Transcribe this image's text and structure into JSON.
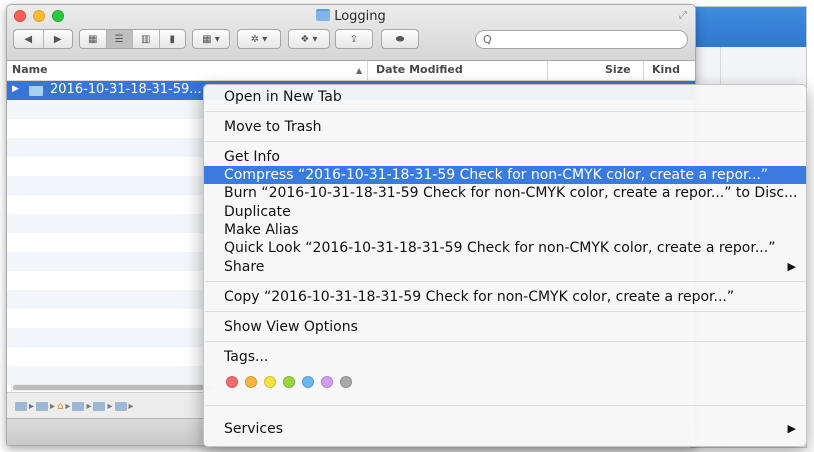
{
  "window": {
    "title": "Logging",
    "search_placeholder": "Q"
  },
  "columns": [
    "Name",
    "Date Modified",
    "Size",
    "Kind"
  ],
  "selected_row": {
    "name": "2016-10-31-18-31-59..."
  },
  "context_menu": {
    "items": [
      {
        "label": "Open in New Tab"
      },
      {
        "label": "Move to Trash"
      },
      {
        "label": "Get Info"
      },
      {
        "label": "Compress “2016-10-31-18-31-59 Check for non-CMYK color, create a repor...”"
      },
      {
        "label": "Burn “2016-10-31-18-31-59 Check for non-CMYK color, create a repor...” to Disc..."
      },
      {
        "label": "Duplicate"
      },
      {
        "label": "Make Alias"
      },
      {
        "label": "Quick Look “2016-10-31-18-31-59 Check for non-CMYK color, create a repor...”"
      },
      {
        "label": "Share"
      },
      {
        "label": "Copy “2016-10-31-18-31-59 Check for non-CMYK color, create a repor...”"
      },
      {
        "label": "Show View Options"
      },
      {
        "label": "Tags..."
      },
      {
        "label": "Services"
      }
    ],
    "highlighted": "Compress",
    "tag_colors": [
      "#f56a6a",
      "#f7b540",
      "#f5e33c",
      "#9ad33b",
      "#6bb8f1",
      "#d29cf0",
      "#a9a9a9"
    ]
  }
}
